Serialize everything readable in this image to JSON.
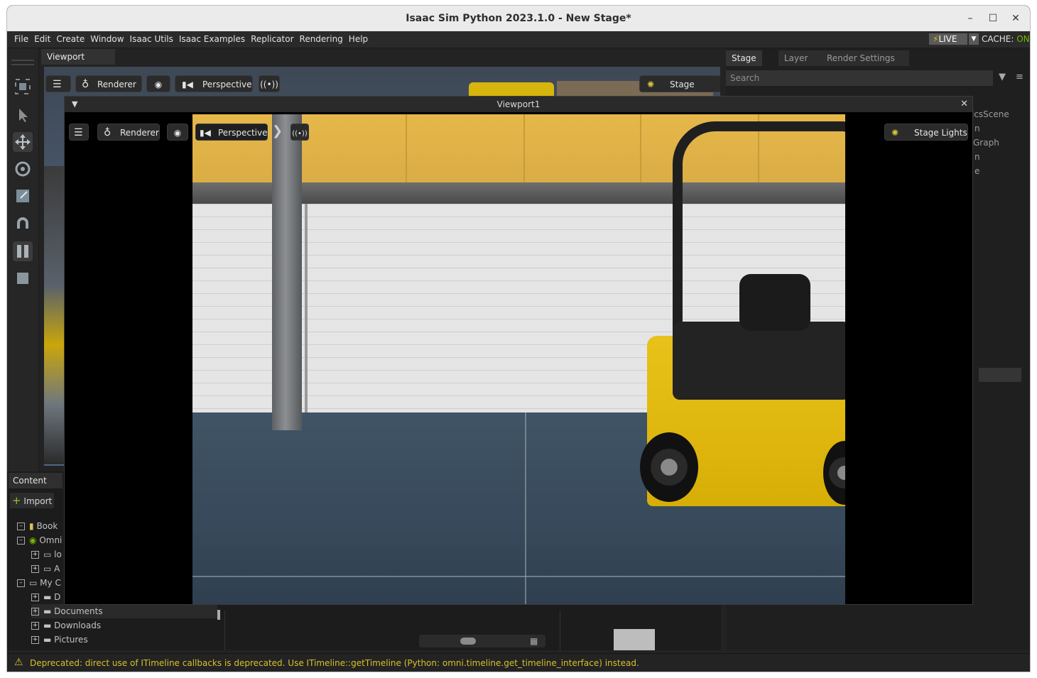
{
  "window": {
    "title": "Isaac Sim Python 2023.1.0 - New Stage*"
  },
  "menubar": {
    "items": [
      "File",
      "Edit",
      "Create",
      "Window",
      "Isaac Utils",
      "Isaac Examples",
      "Replicator",
      "Rendering",
      "Help"
    ],
    "live_label": "LIVE",
    "cache_label": "CACHE:",
    "cache_state": "ON"
  },
  "viewport_main": {
    "tab": "Viewport",
    "renderer_label": "Renderer",
    "camera_label": "Perspective",
    "lights_label": "Stage Lights"
  },
  "viewport1": {
    "title": "Viewport1",
    "renderer_label": "Renderer",
    "camera_label": "Perspective",
    "lights_label": "Stage Lights"
  },
  "stage_panel": {
    "tabs": [
      "Stage",
      "Layer",
      "Render Settings"
    ],
    "search_placeholder": "Search",
    "partial_items": [
      "icsScene",
      "n",
      "Graph",
      "n",
      "e"
    ]
  },
  "content_panel": {
    "tab": "Content",
    "import_label": "Import",
    "tree": [
      {
        "label": "Book",
        "icon": "bookmark-icon"
      },
      {
        "label": "Omni",
        "icon": "omniverse-icon"
      },
      {
        "label": "lo",
        "icon": "server-icon"
      },
      {
        "label": "A",
        "icon": "server-icon"
      },
      {
        "label": "My C",
        "icon": "computer-icon"
      },
      {
        "label": "D",
        "icon": "drive-icon"
      },
      {
        "label": "Documents",
        "icon": "drive-icon"
      },
      {
        "label": "Downloads",
        "icon": "drive-icon"
      },
      {
        "label": "Pictures",
        "icon": "drive-icon"
      }
    ]
  },
  "statusbar": {
    "message": "Deprecated: direct use of ITimeline callbacks is deprecated. Use ITimeline::getTimeline (Python: omni.timeline.get_timeline_interface) instead."
  },
  "colors": {
    "accent_green": "#76b900",
    "warning_yellow": "#d7c12a",
    "forklift_yellow": "#e0b810"
  }
}
